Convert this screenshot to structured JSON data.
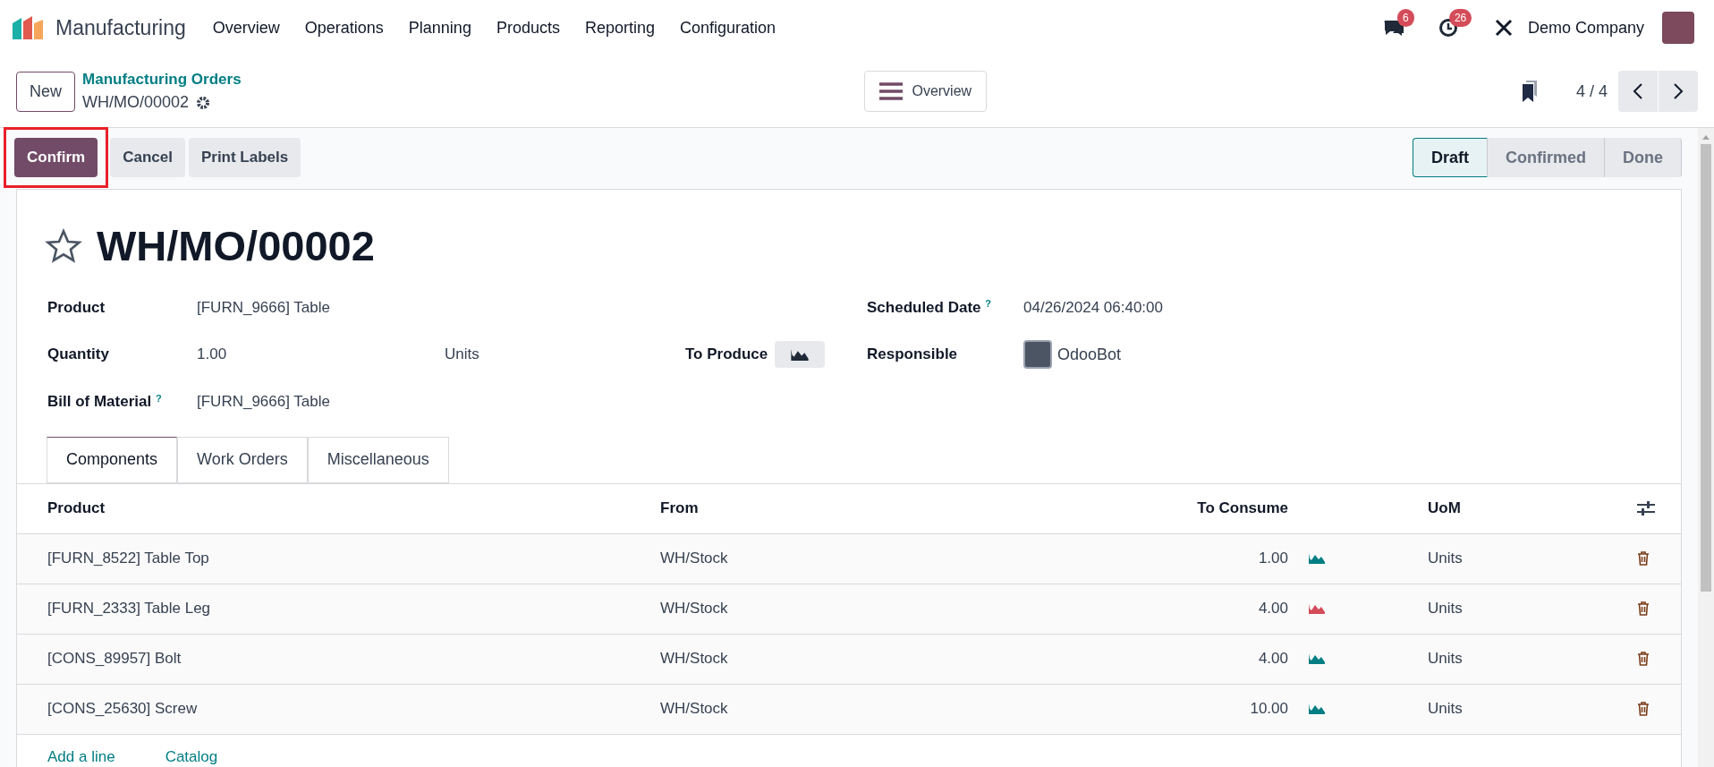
{
  "app": {
    "name": "Manufacturing"
  },
  "menu": [
    "Overview",
    "Operations",
    "Planning",
    "Products",
    "Reporting",
    "Configuration"
  ],
  "systray": {
    "messages_count": "6",
    "activities_count": "26",
    "company": "Demo Company"
  },
  "control_panel": {
    "new_button": "New",
    "breadcrumb": "Manufacturing Orders",
    "record": "WH/MO/00002",
    "overview_button": "Overview",
    "pager": "4 / 4"
  },
  "actions": [
    {
      "label": "Confirm",
      "kind": "primary",
      "highlighted": true
    },
    {
      "label": "Cancel",
      "kind": "secondary",
      "highlighted": false
    },
    {
      "label": "Print Labels",
      "kind": "secondary",
      "highlighted": false
    }
  ],
  "status_steps": [
    {
      "label": "Draft",
      "selected": true
    },
    {
      "label": "Confirmed",
      "selected": false
    },
    {
      "label": "Done",
      "selected": false
    }
  ],
  "form": {
    "title": "WH/MO/00002",
    "starred": false,
    "product": {
      "label": "Product",
      "value": "[FURN_9666] Table"
    },
    "quantity": {
      "label": "Quantity",
      "value": "1.00",
      "uom": "Units",
      "to_produce_label": "To Produce"
    },
    "bom": {
      "label": "Bill of Material",
      "help": "?",
      "value": "[FURN_9666] Table"
    },
    "scheduled": {
      "label": "Scheduled Date",
      "help": "?",
      "value": "04/26/2024 06:40:00"
    },
    "responsible": {
      "label": "Responsible",
      "value": "OdooBot"
    }
  },
  "tabs": [
    {
      "label": "Components",
      "selected": true
    },
    {
      "label": "Work Orders",
      "selected": false
    },
    {
      "label": "Miscellaneous",
      "selected": false
    }
  ],
  "table": {
    "columns": [
      "Product",
      "From",
      "To Consume",
      "UoM"
    ],
    "rows": [
      {
        "product": "[FURN_8522] Table Top",
        "from": "WH/Stock",
        "to_consume": "1.00",
        "color": "#017e84",
        "uom": "Units"
      },
      {
        "product": "[FURN_2333] Table Leg",
        "from": "WH/Stock",
        "to_consume": "4.00",
        "color": "#d44c59",
        "uom": "Units"
      },
      {
        "product": "[CONS_89957] Bolt",
        "from": "WH/Stock",
        "to_consume": "4.00",
        "color": "#017e84",
        "uom": "Units"
      },
      {
        "product": "[CONS_25630] Screw",
        "from": "WH/Stock",
        "to_consume": "10.00",
        "color": "#017e84",
        "uom": "Units"
      }
    ],
    "links": [
      "Add a line",
      "Catalog"
    ]
  }
}
